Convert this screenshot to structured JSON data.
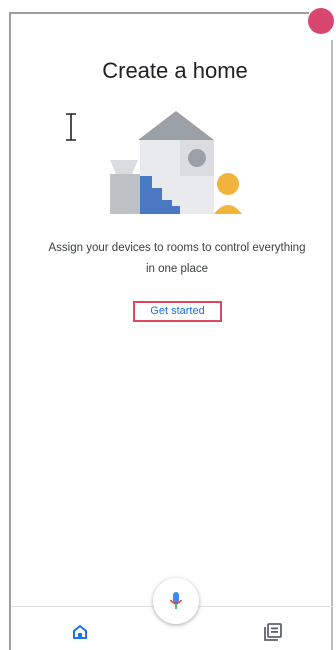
{
  "header": {
    "title": "Create a home"
  },
  "main": {
    "description_line1": "Assign your devices to rooms to control everything",
    "description_line2": "in one place",
    "cta_label": "Get started"
  },
  "bottom_nav": {
    "left_icon": "home-icon",
    "center_icon": "microphone-icon",
    "right_icon": "feed-icon"
  },
  "colors": {
    "accent": "#1a73e8",
    "highlight_border": "#e0475f",
    "avatar": "#d9466f"
  }
}
